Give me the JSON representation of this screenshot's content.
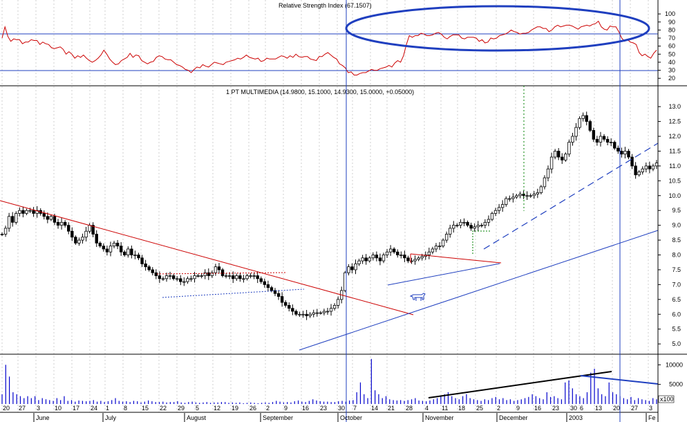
{
  "chart_data": {
    "type": "candlestick",
    "colors": {
      "background": "#ffffff",
      "grid": "#b0b0b0",
      "rsi_line": "#cc0000",
      "candle": "#000000",
      "volume_bar": "#0000cc",
      "trendline_blue": "#1f3fbf",
      "trendline_red": "#cc0000",
      "markup_black": "#000000",
      "projection_green": "#008000"
    },
    "icons": [
      "bull-icon"
    ],
    "rsi_panel": {
      "title": "Relative Strength Index (67.1507)",
      "yticks": [
        "100",
        "90",
        "80",
        "70",
        "60",
        "50",
        "40",
        "30",
        "20"
      ],
      "ylim": [
        15,
        107
      ],
      "reference_levels": [
        70,
        30
      ],
      "values": [
        70,
        84,
        72,
        66,
        69,
        68,
        68,
        63,
        65,
        65,
        68,
        67,
        67,
        62,
        65,
        63,
        62,
        58,
        57,
        58,
        59,
        56,
        50,
        53,
        50,
        45,
        48,
        46,
        49,
        45,
        42,
        40,
        42,
        45,
        49,
        55,
        50,
        44,
        40,
        37,
        38,
        42,
        44,
        46,
        51,
        46,
        49,
        48,
        42,
        40,
        38,
        40,
        41,
        46,
        48,
        47,
        44,
        43,
        43,
        40,
        37,
        36,
        34,
        31,
        30,
        27,
        31,
        34,
        33,
        37,
        35,
        34,
        37,
        40,
        39,
        38,
        37,
        40,
        41,
        42,
        43,
        45,
        44,
        46,
        49,
        46,
        45,
        44,
        45,
        41,
        42,
        45,
        44,
        44,
        44,
        46,
        48,
        47,
        45,
        48,
        46,
        50,
        47,
        46,
        47,
        47,
        44,
        43,
        42,
        47,
        47,
        50,
        52,
        49,
        46,
        44,
        38,
        36,
        33,
        27,
        28,
        24,
        24,
        26,
        27,
        27,
        29,
        31,
        30,
        30,
        32,
        33,
        34,
        36,
        34,
        39,
        42,
        40,
        48,
        62,
        73,
        71,
        73,
        73,
        76,
        75,
        73,
        73,
        74,
        76,
        77,
        75,
        71,
        69,
        72,
        74,
        74,
        74,
        70,
        69,
        71,
        71,
        71,
        70,
        66,
        68,
        64,
        65,
        70,
        69,
        70,
        73,
        74,
        75,
        77,
        80,
        78,
        77,
        75,
        76,
        76,
        77,
        80,
        82,
        84,
        84,
        82,
        82,
        78,
        80,
        84,
        86,
        84,
        85,
        86,
        86,
        85,
        83,
        81,
        84,
        85,
        86,
        85,
        87,
        88,
        91,
        84,
        81,
        80,
        85,
        84,
        84,
        78,
        70,
        66,
        68,
        65,
        64,
        62,
        52,
        48,
        50,
        47,
        45,
        51,
        55
      ]
    },
    "price_panel": {
      "title": "1 PT MULTIMEDIA (14.9800, 15.1000, 14.9300, 15.0000, +0.05000)",
      "yticks": [
        "13.0",
        "12.5",
        "12.0",
        "11.5",
        "11.0",
        "10.5",
        "10.0",
        "9.5",
        "9.0",
        "8.5",
        "8.0",
        "7.5",
        "7.0",
        "6.5",
        "6.0",
        "5.5",
        "5.0"
      ],
      "ylim": [
        4.7,
        13.33
      ],
      "closes": [
        8.7,
        8.9,
        9.3,
        9.1,
        9.4,
        9.5,
        9.4,
        9.5,
        9.5,
        9.4,
        9.5,
        9.4,
        9.3,
        9.2,
        9.3,
        9.1,
        9.0,
        9.1,
        9.0,
        8.8,
        8.6,
        8.4,
        8.5,
        8.6,
        8.8,
        9.0,
        8.7,
        8.4,
        8.3,
        8.2,
        8.1,
        8.3,
        8.4,
        8.3,
        8.1,
        8.0,
        8.2,
        8.0,
        8.0,
        7.9,
        7.7,
        7.6,
        7.5,
        7.4,
        7.3,
        7.2,
        7.2,
        7.3,
        7.3,
        7.2,
        7.2,
        7.1,
        7.1,
        7.2,
        7.2,
        7.3,
        7.3,
        7.3,
        7.4,
        7.3,
        7.4,
        7.6,
        7.5,
        7.3,
        7.3,
        7.3,
        7.2,
        7.3,
        7.2,
        7.2,
        7.3,
        7.3,
        7.3,
        7.2,
        7.1,
        7.0,
        6.9,
        6.8,
        6.7,
        6.6,
        6.4,
        6.3,
        6.2,
        6.1,
        6.0,
        6.0,
        6.0,
        5.95,
        6.0,
        6.05,
        6.05,
        6.05,
        6.1,
        6.1,
        6.2,
        6.3,
        6.5,
        6.8,
        7.4,
        7.6,
        7.5,
        7.7,
        7.8,
        7.9,
        7.8,
        7.9,
        8.0,
        7.9,
        7.8,
        8.0,
        8.1,
        8.2,
        8.1,
        8.0,
        8.0,
        7.9,
        7.8,
        7.8,
        7.85,
        7.9,
        7.95,
        8.0,
        8.1,
        8.2,
        8.3,
        8.3,
        8.5,
        8.7,
        8.9,
        9.0,
        9.0,
        9.1,
        9.1,
        9.0,
        8.9,
        8.95,
        9.0,
        9.0,
        9.1,
        9.2,
        9.4,
        9.5,
        9.6,
        9.7,
        9.9,
        9.9,
        9.95,
        10.0,
        10.05,
        10.0,
        10.0,
        10.0,
        10.05,
        10.1,
        10.3,
        10.6,
        10.9,
        11.3,
        11.5,
        11.3,
        11.2,
        11.4,
        11.8,
        12.0,
        12.3,
        12.6,
        12.7,
        12.5,
        12.2,
        11.9,
        11.8,
        12.0,
        11.9,
        11.8,
        11.8,
        11.6,
        11.5,
        11.4,
        11.5,
        11.3,
        11.0,
        10.7,
        10.8,
        10.9,
        11.0,
        10.9,
        11.0,
        11.1
      ]
    },
    "volume_panel": {
      "yticks": [
        "10000",
        "5000"
      ],
      "unit_label": "x100",
      "ylim": [
        0,
        12000
      ],
      "values": [
        2500,
        10000,
        7000,
        3000,
        2500,
        2000,
        1500,
        2000,
        1500,
        2000,
        1000,
        1500,
        1200,
        1000,
        800,
        1500,
        1000,
        2000,
        800,
        1000,
        600,
        900,
        800,
        700,
        800,
        1000,
        600,
        800,
        500,
        700,
        1000,
        1500,
        800,
        600,
        700,
        500,
        800,
        700,
        400,
        600,
        900,
        700,
        500,
        500,
        600,
        400,
        500,
        500,
        700,
        400,
        300,
        500,
        600,
        400,
        300,
        400,
        500,
        300,
        400,
        400,
        500,
        500,
        300,
        400,
        300,
        400,
        200,
        300,
        400,
        300,
        200,
        300,
        400,
        300,
        500,
        800,
        600,
        400,
        500,
        400,
        700,
        900,
        600,
        500,
        800,
        1200,
        900,
        700,
        600,
        600,
        500,
        500,
        700,
        800,
        600,
        900,
        1000,
        3000,
        5500,
        2500,
        1500,
        11500,
        3500,
        2500,
        1500,
        2000,
        1200,
        1000,
        900,
        1000,
        800,
        1000,
        1200,
        1500,
        900,
        800,
        700,
        900,
        1200,
        1500,
        2000,
        2500,
        3000,
        2000,
        1500,
        1200,
        2000,
        2500,
        1500,
        1200,
        1000,
        800,
        1200,
        1000,
        1500,
        1800,
        1200,
        1500,
        1000,
        1200,
        800,
        1000,
        1200,
        1500,
        1800,
        2500,
        2000,
        1500,
        1200,
        3000,
        1800,
        2000,
        1500,
        1200,
        5500,
        6000,
        4000,
        2500,
        2000,
        1500,
        3000,
        8000,
        9000,
        4000,
        2500,
        2000,
        5500,
        3000,
        2500,
        2000,
        1500,
        1200,
        1800,
        1000,
        1500,
        1200,
        1000,
        800,
        1500,
        1200
      ]
    },
    "x_axis": {
      "day_labels": [
        "20",
        "27",
        "3",
        "10",
        "17",
        "24",
        "1",
        "8",
        "15",
        "22",
        "29",
        "5",
        "12",
        "19",
        "26",
        "2",
        "9",
        "16",
        "23",
        "30",
        "7",
        "14",
        "21",
        "28",
        "4",
        "11",
        "18",
        "25",
        "2",
        "9",
        "16",
        "23",
        "30",
        "6",
        "13",
        "20",
        "27",
        "3"
      ],
      "month_labels": [
        "June",
        "July",
        "August",
        "September",
        "October",
        "November",
        "December",
        "2003",
        "Fe"
      ]
    }
  }
}
